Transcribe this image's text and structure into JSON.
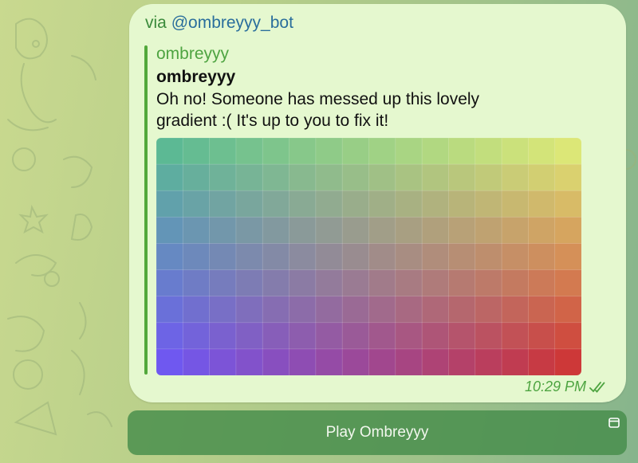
{
  "message": {
    "via_prefix": "via",
    "via_bot": "@ombreyyy_bot",
    "bot_name": "ombreyyy",
    "game_title": "ombreyyy",
    "game_description": "Oh no! Someone has messed up this lovely gradient :( It's up to you to fix it!",
    "time": "10:29 PM",
    "status_icon": "double-check-icon"
  },
  "game_board": {
    "rows": 9,
    "cols": 16,
    "corner_colors": {
      "top_left": "#5cb994",
      "top_right": "#dce777",
      "bottom_left": "#6f58f0",
      "bottom_right": "#cd3838"
    }
  },
  "play_button": {
    "label": "Play Ombreyyy",
    "icon": "app-window-icon"
  },
  "colors": {
    "bubble_bg": "#e5f8cf",
    "accent_green": "#4ea441",
    "link_blue": "#2a6e9c",
    "button_bg": "#4f9356"
  }
}
